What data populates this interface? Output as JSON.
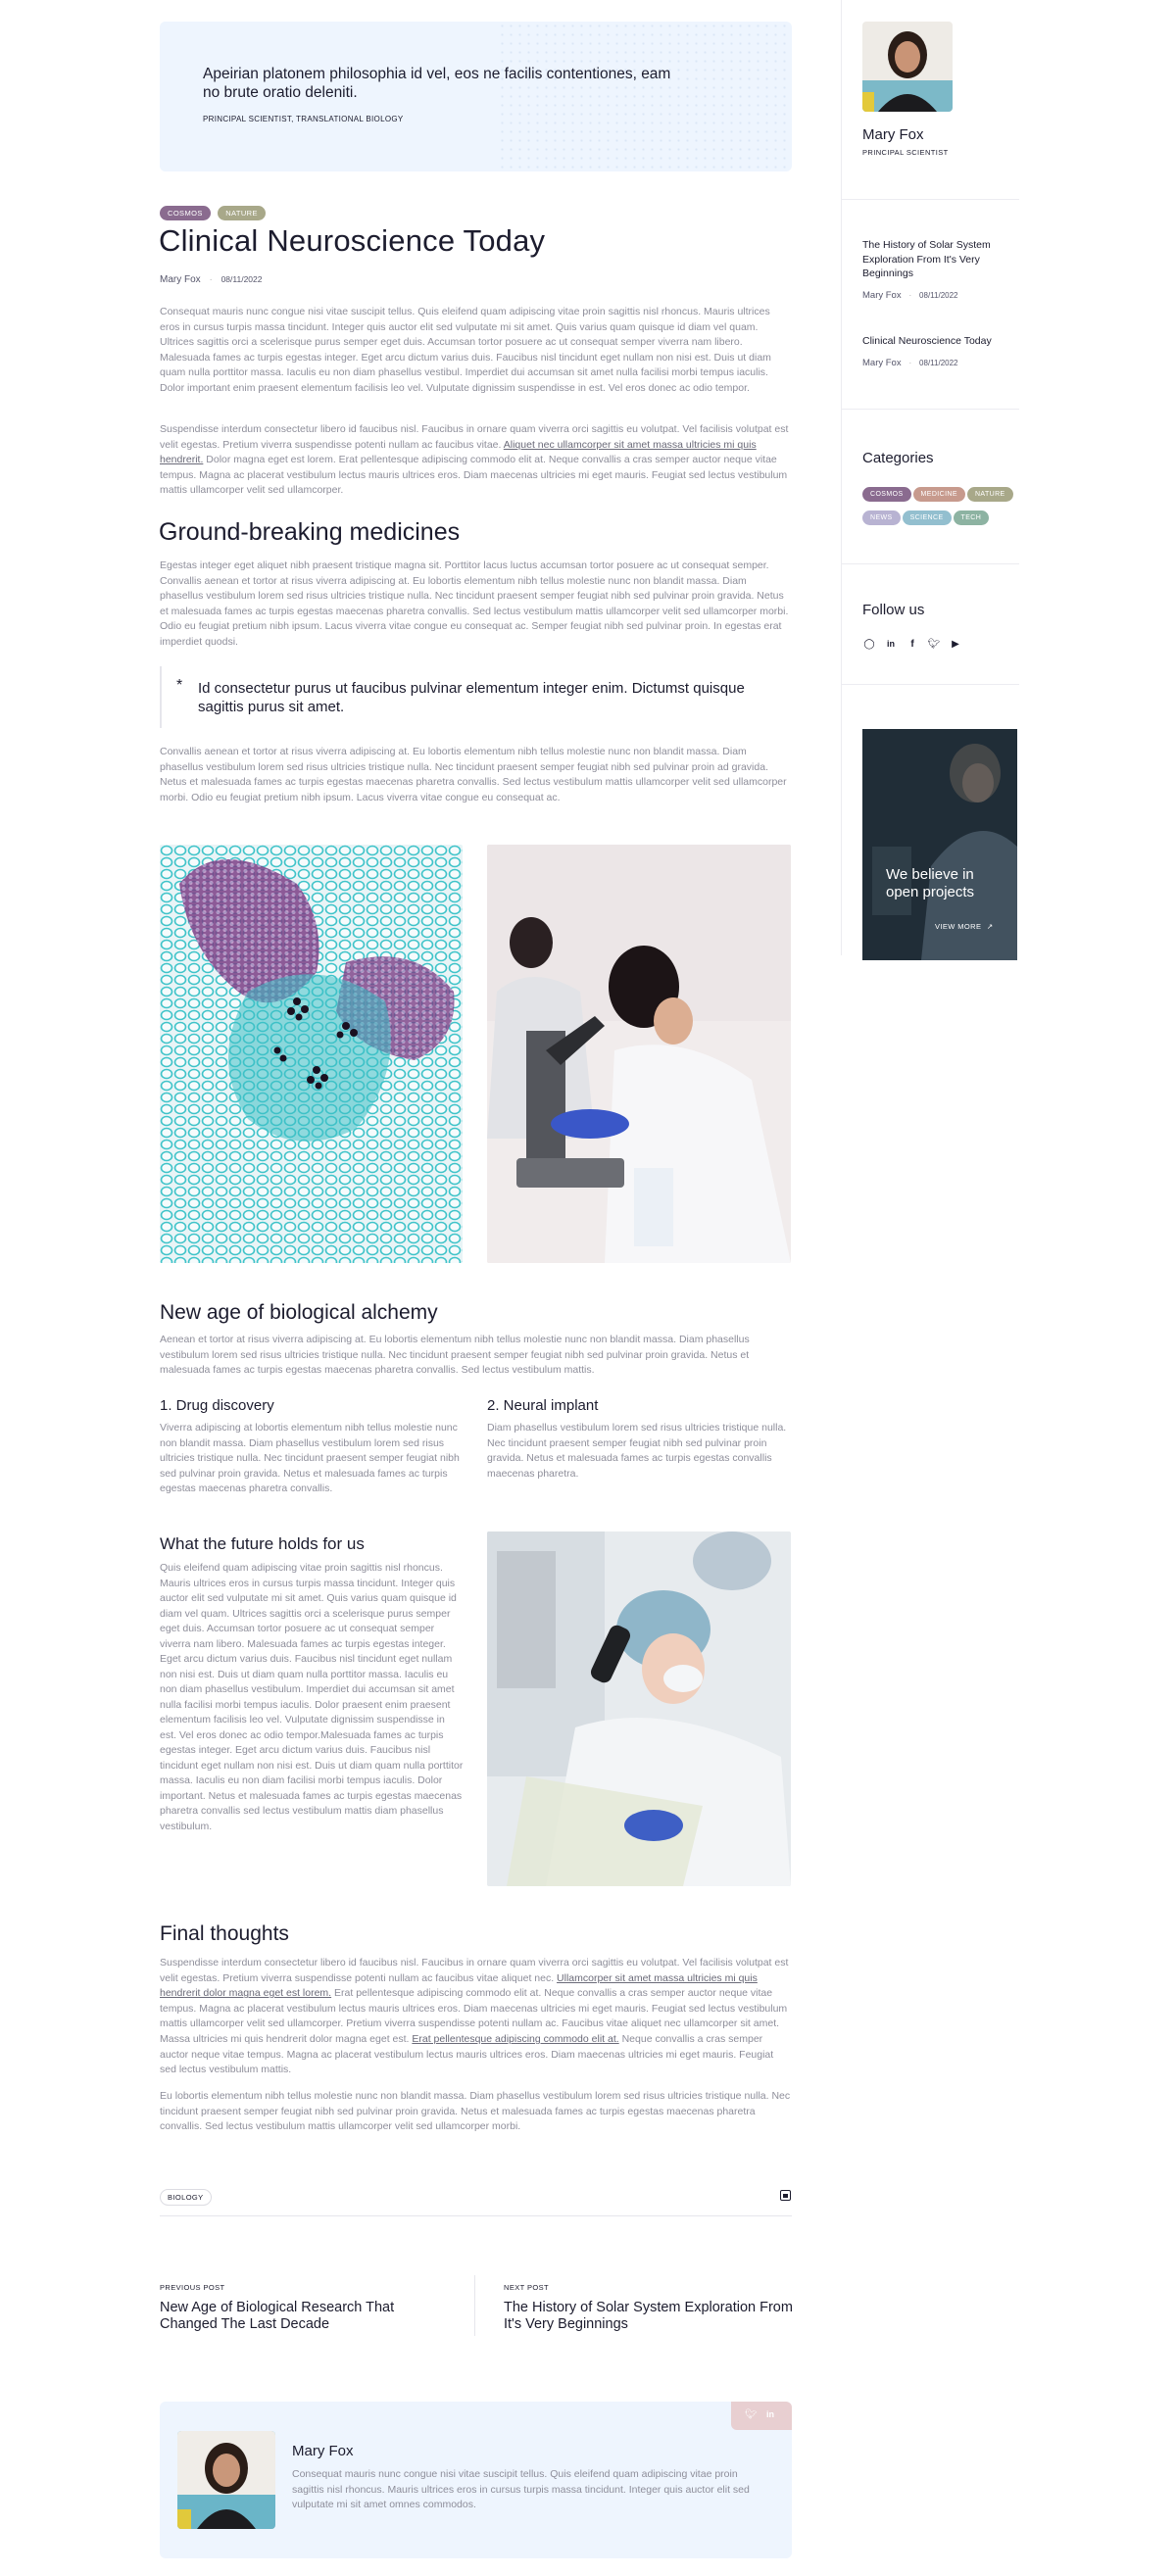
{
  "hero_quote": {
    "text": "Apeirian platonem philosophia id vel, eos ne facilis contentiones, eam no brute oratio deleniti.",
    "attribution": "PRINCIPAL SCIENTIST, TRANSLATIONAL BIOLOGY"
  },
  "post": {
    "tags": [
      {
        "label": "COSMOS",
        "color": "#8a6b8f"
      },
      {
        "label": "NATURE",
        "color": "#a8a889"
      }
    ],
    "title": "Clinical Neuroscience Today",
    "author": "Mary Fox",
    "date": "08/11/2022",
    "intro_p1": "Consequat mauris nunc congue nisi vitae suscipit tellus. Quis eleifend quam adipiscing vitae proin sagittis nisl rhoncus. Mauris ultrices eros in cursus turpis massa tincidunt. Integer quis auctor elit sed vulputate mi sit amet. Quis varius quam quisque id diam vel quam. Ultrices sagittis orci a scelerisque purus semper eget duis. Accumsan tortor posuere ac ut consequat semper viverra nam libero. Malesuada fames ac turpis egestas integer. Eget arcu dictum varius duis. Faucibus nisl tincidunt eget nullam non nisi est. Duis ut diam quam nulla porttitor massa. Iaculis eu non diam phasellus vestibul. Imperdiet dui accumsan sit amet nulla facilisi morbi tempus iaculis. Dolor important enim praesent elementum facilisis leo vel. Vulputate dignissim suspendisse in est. Vel eros donec ac odio tempor.",
    "intro_p2_a": "Suspendisse interdum consectetur libero id faucibus nisl. Faucibus in ornare quam viverra orci sagittis eu volutpat. Vel facilisis volutpat est velit egestas. Pretium viverra suspendisse potenti nullam ac faucibus vitae. ",
    "intro_p2_link": "Aliquet nec ullamcorper sit amet massa ultricies mi quis hendrerit.",
    "intro_p2_b": " Dolor magna eget est lorem. Erat pellentesque adipiscing commodo elit at. Neque convallis a cras semper auctor neque vitae tempus. Magna ac placerat vestibulum lectus mauris ultrices eros. Diam maecenas ultricies mi eget mauris. Feugiat sed lectus vestibulum mattis ullamcorper velit sed ullamcorper.",
    "h_medicines": "Ground-breaking medicines",
    "medicines_p": "Egestas integer eget aliquet nibh praesent tristique magna sit. Porttitor lacus luctus accumsan tortor posuere ac ut consequat semper. Convallis aenean et tortor at risus viverra adipiscing at. Eu lobortis elementum nibh tellus molestie nunc non blandit massa. Diam phasellus vestibulum lorem sed risus ultricies tristique nulla. Nec tincidunt praesent semper feugiat nibh sed pulvinar proin gravida. Netus et malesuada fames ac turpis egestas maecenas pharetra convallis. Sed lectus vestibulum mattis ullamcorper velit sed ullamcorper morbi. Odio eu feugiat pretium nibh ipsum. Lacus viverra vitae congue eu consequat ac. Semper feugiat nibh sed pulvinar proin. In egestas erat imperdiet quodsi.",
    "blockquote": "Id consectetur purus ut faucibus pulvinar elementum integer enim. Dictumst quisque sagittis purus sit amet.",
    "after_quote_p": "Convallis aenean et tortor at risus viverra adipiscing at. Eu lobortis elementum nibh tellus molestie nunc non blandit massa. Diam phasellus vestibulum lorem sed risus ultricies tristique nulla. Nec tincidunt praesent semper feugiat nibh sed pulvinar proin ad gravida. Netus et malesuada fames ac turpis egestas maecenas pharetra convallis. Sed lectus vestibulum mattis ullamcorper velit sed ullamcorper morbi. Odio eu feugiat pretium nibh ipsum. Lacus viverra vitae congue eu consequat ac.",
    "h_alchemy": "New age of biological alchemy",
    "alchemy_p": "Aenean et tortor at risus viverra adipiscing at. Eu lobortis elementum nibh tellus molestie nunc non blandit massa. Diam phasellus vestibulum lorem sed risus ultricies tristique nulla. Nec tincidunt praesent semper feugiat nibh sed pulvinar proin gravida. Netus et malesuada fames ac turpis egestas maecenas pharetra convallis. Sed lectus vestibulum mattis.",
    "h_drug": "1. Drug discovery",
    "drug_p": "Viverra adipiscing at lobortis elementum nibh tellus molestie nunc non blandit massa. Diam phasellus vestibulum lorem sed risus ultricies tristique nulla. Nec tincidunt praesent semper feugiat nibh sed pulvinar proin gravida. Netus et malesuada fames ac turpis egestas maecenas pharetra convallis.",
    "h_neural": "2. Neural implant",
    "neural_p": "Diam phasellus vestibulum lorem sed risus ultricies tristique nulla. Nec tincidunt praesent semper feugiat nibh sed pulvinar proin gravida. Netus et malesuada fames ac turpis egestas convallis maecenas pharetra.",
    "h_future": "What the future holds for us",
    "future_p": "Quis eleifend quam adipiscing vitae proin sagittis nisl rhoncus. Mauris ultrices eros in cursus turpis massa tincidunt. Integer quis auctor elit sed vulputate mi sit amet. Quis varius quam quisque id diam vel quam. Ultrices sagittis orci a scelerisque purus semper eget duis. Accumsan tortor posuere ac ut consequat semper viverra nam libero. Malesuada fames ac turpis egestas integer. Eget arcu dictum varius duis. Faucibus nisl tincidunt eget nullam non nisi est. Duis ut diam quam nulla porttitor massa. Iaculis eu non diam phasellus vestibulum. Imperdiet dui accumsan sit amet nulla facilisi morbi tempus iaculis. Dolor praesent enim praesent elementum facilisis leo vel. Vulputate dignissim suspendisse in est. Vel eros donec ac odio tempor.Malesuada fames ac turpis egestas integer. Eget arcu dictum varius duis. Faucibus nisl tincidunt eget nullam non nisi est. Duis ut diam quam nulla porttitor massa. Iaculis eu non diam facilisi morbi tempus iaculis. Dolor important. Netus et malesuada fames ac turpis egestas maecenas pharetra convallis sed lectus vestibulum mattis diam phasellus vestibulum.",
    "h_final": "Final thoughts",
    "final_p1_a": "Suspendisse interdum consectetur libero id faucibus nisl. Faucibus in ornare quam viverra orci sagittis eu volutpat. Vel facilisis volutpat est velit egestas. Pretium viverra suspendisse potenti nullam ac faucibus vitae aliquet nec. ",
    "final_p1_link1": "Ullamcorper sit amet massa ultricies mi quis hendrerit dolor magna eget est lorem.",
    "final_p1_b": " Erat pellentesque adipiscing commodo elit at. Neque convallis a cras semper auctor neque vitae tempus. Magna ac placerat vestibulum lectus mauris ultrices eros. Diam maecenas ultricies mi eget mauris. Feugiat sed lectus vestibulum mattis ullamcorper velit sed ullamcorper. Pretium viverra suspendisse potenti nullam ac. Faucibus vitae aliquet nec ullamcorper sit amet. Massa ultricies mi quis hendrerit dolor magna eget est. ",
    "final_p1_link2": "Erat pellentesque adipiscing commodo elit at.",
    "final_p1_c": " Neque convallis a cras semper auctor neque vitae tempus. Magna ac placerat vestibulum lectus mauris ultrices eros. Diam maecenas ultricies mi eget mauris. Feugiat sed lectus vestibulum mattis.",
    "final_p2": "Eu lobortis elementum nibh tellus molestie nunc non blandit massa. Diam phasellus vestibulum lorem sed risus ultricies tristique nulla. Nec tincidunt praesent semper feugiat nibh sed pulvinar proin gravida. Netus et malesuada fames ac turpis egestas maecenas pharetra convallis. Sed lectus vestibulum mattis ullamcorper velit sed ullamcorper morbi.",
    "bottom_tag": "BIOLOGY"
  },
  "post_nav": {
    "prev_label": "PREVIOUS POST",
    "prev_title": "New Age of Biological Research That Changed The Last Decade",
    "next_label": "NEXT POST",
    "next_title": "The History of Solar System Exploration From It's Very Beginnings"
  },
  "author_box": {
    "name": "Mary Fox",
    "bio": "Consequat mauris nunc congue nisi vitae suscipit tellus. Quis eleifend quam adipiscing vitae proin sagittis nisl rhoncus. Mauris ultrices eros in cursus turpis massa tincidunt. Integer quis auctor elit sed vulputate mi sit amet omnes commodos."
  },
  "sidebar": {
    "author_name": "Mary Fox",
    "author_role": "PRINCIPAL SCIENTIST",
    "recent_posts": [
      {
        "title": "The History of Solar System Exploration From It's Very Beginnings",
        "author": "Mary Fox",
        "date": "08/11/2022"
      },
      {
        "title": "Clinical Neuroscience Today",
        "author": "Mary Fox",
        "date": "08/11/2022"
      }
    ],
    "categories_title": "Categories",
    "categories": [
      {
        "label": "COSMOS",
        "color": "#8a6b8f"
      },
      {
        "label": "MEDICINE",
        "color": "#c79a8d"
      },
      {
        "label": "NATURE",
        "color": "#a8a889"
      },
      {
        "label": "NEWS",
        "color": "#b8b3d2"
      },
      {
        "label": "SCIENCE",
        "color": "#93bfcf"
      },
      {
        "label": "TECH",
        "color": "#8db3a2"
      }
    ],
    "follow_title": "Follow us",
    "banner_text": "We believe in open projects",
    "banner_link": "VIEW MORE"
  },
  "colors": {
    "accent_bg": "#eef5fe",
    "text_dark": "#1c1c2e",
    "text_muted": "#8e8e9a"
  }
}
